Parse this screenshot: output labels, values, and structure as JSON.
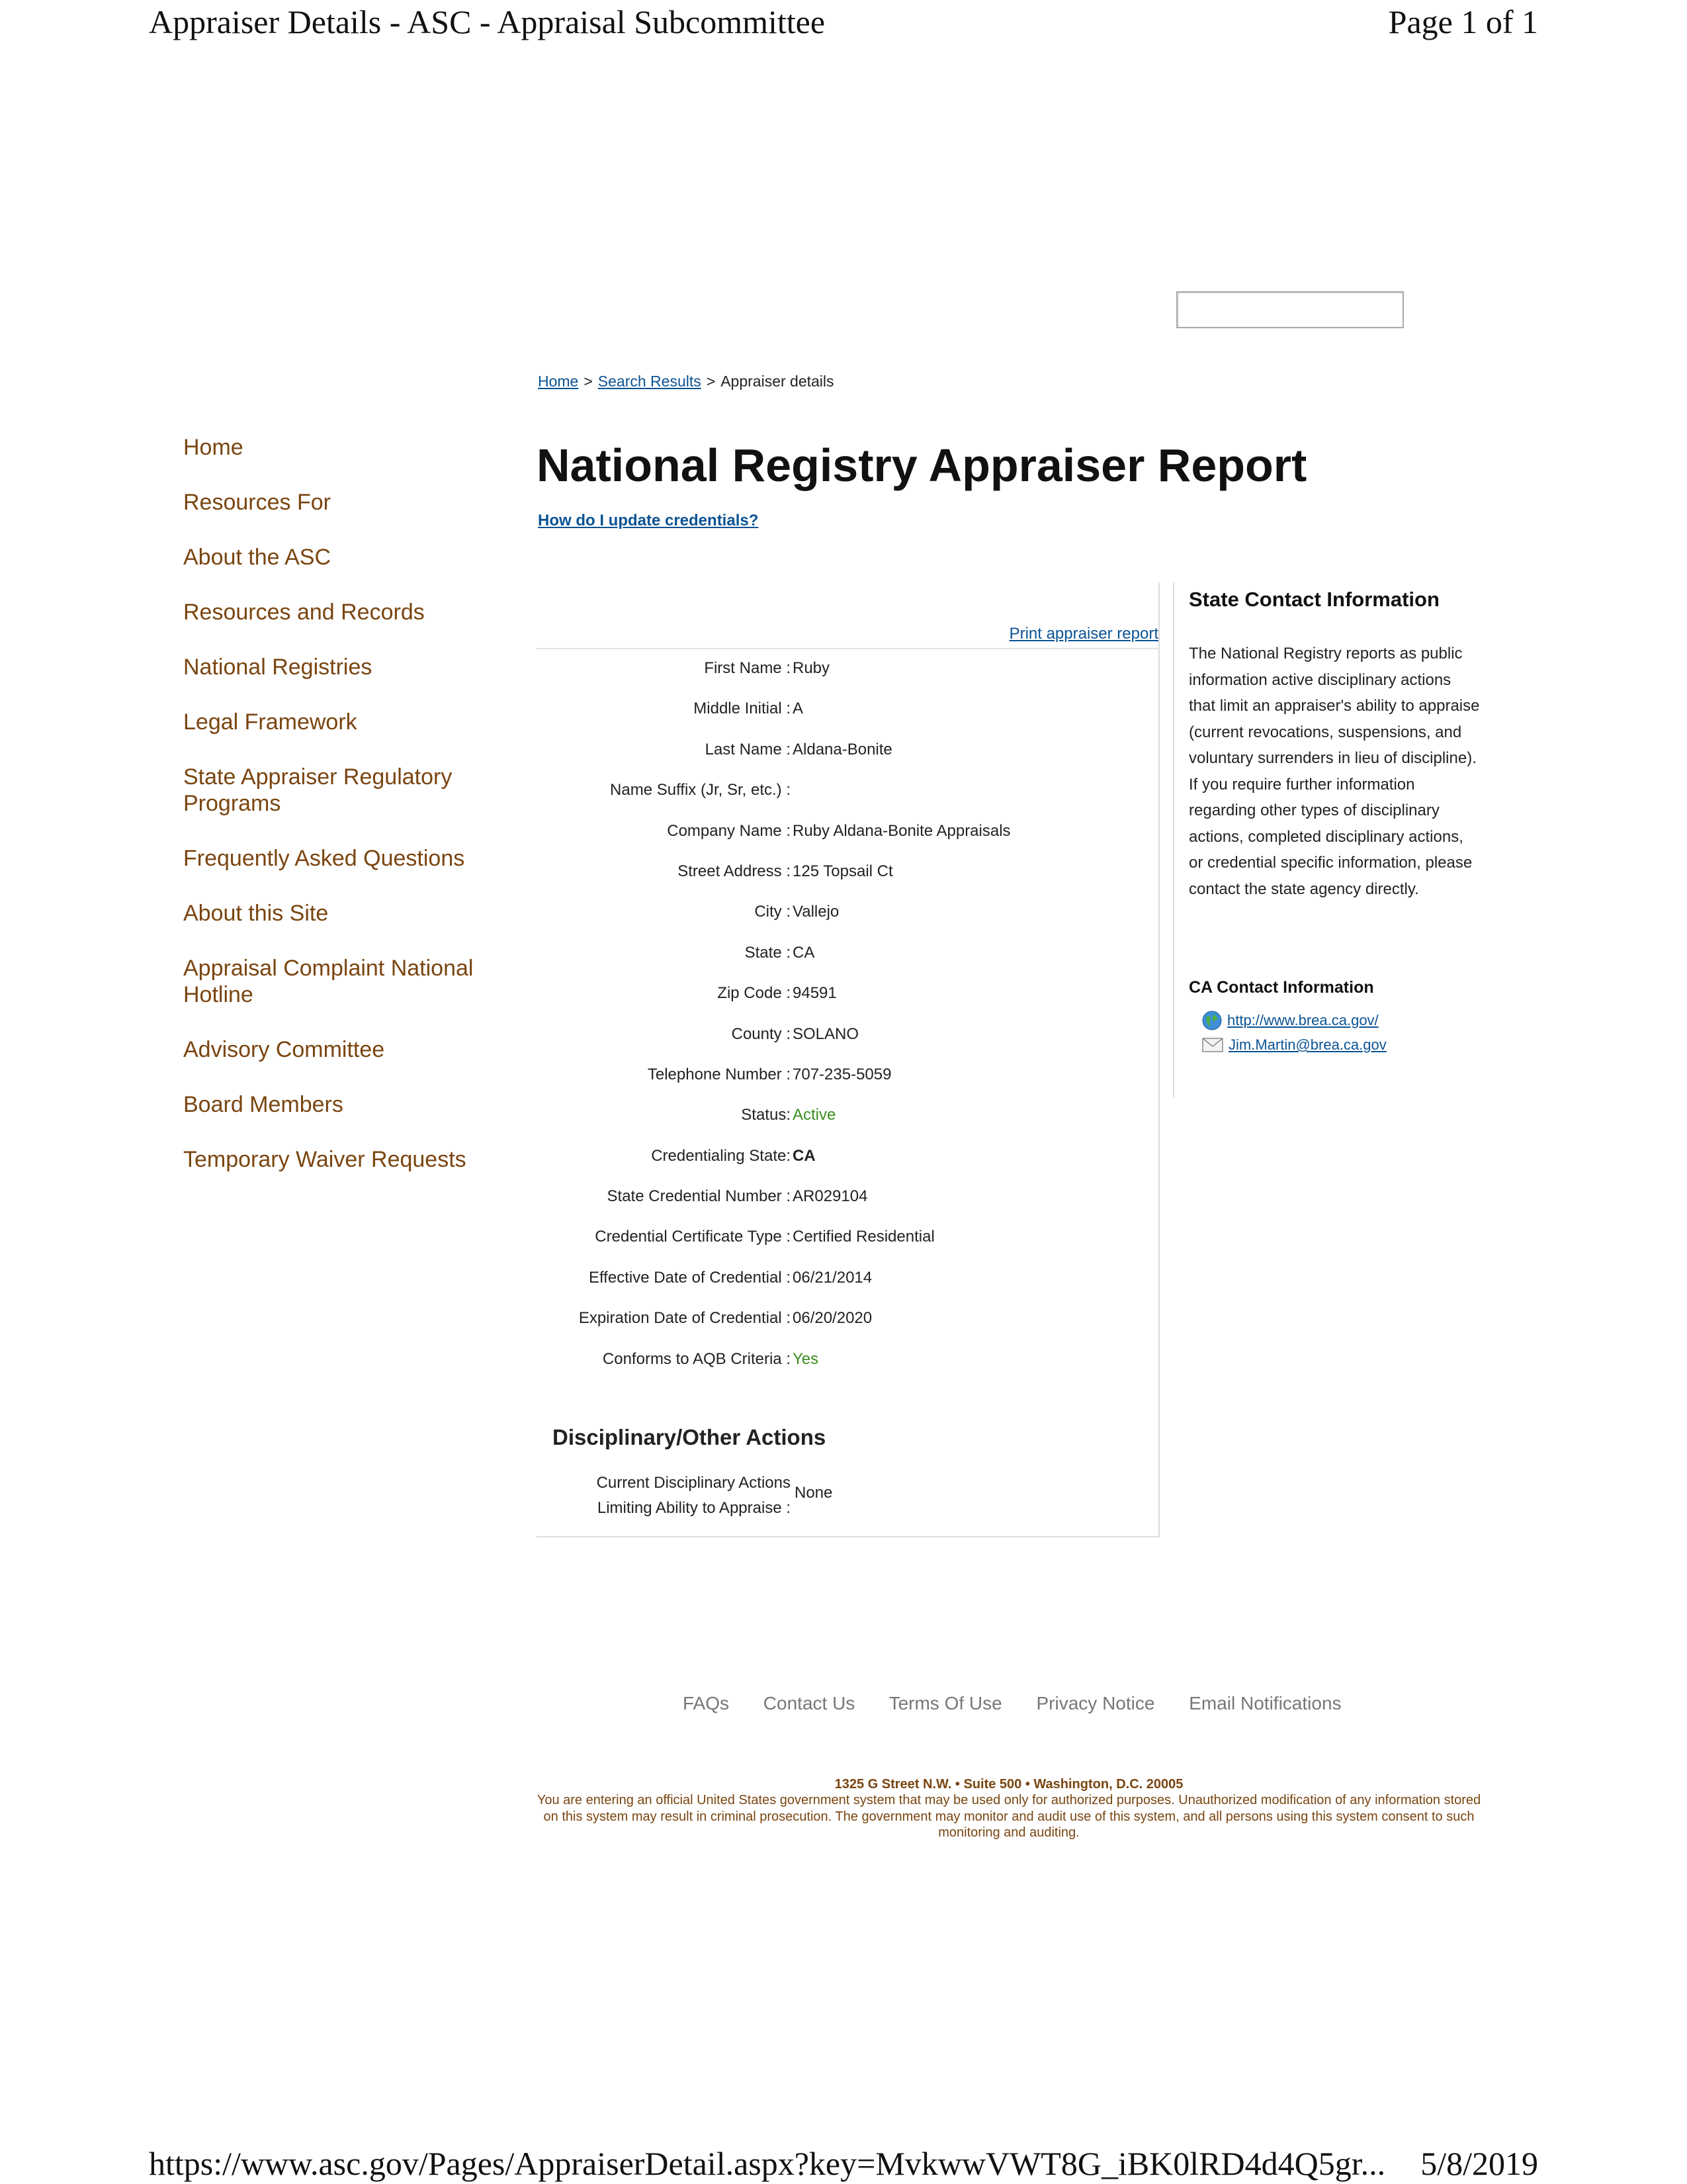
{
  "print_header": {
    "title": "Appraiser Details - ASC - Appraisal Subcommittee",
    "page": "Page 1 of 1"
  },
  "print_footer": {
    "url": "https://www.asc.gov/Pages/AppraiserDetail.aspx?key=MvkwwVWT8G_iBK0lRD4d4Q5gr...",
    "date": "5/8/2019"
  },
  "search": {
    "placeholder": ""
  },
  "breadcrumb": {
    "home": "Home",
    "sep": ">",
    "search_results": "Search Results",
    "current": "Appraiser details"
  },
  "nav": {
    "items": [
      "Home",
      "Resources For",
      "About the ASC",
      "Resources and Records",
      "National Registries",
      "Legal Framework",
      "State Appraiser Regulatory Programs",
      "Frequently Asked Questions",
      "About this Site",
      "Appraisal Complaint National Hotline",
      "Advisory Committee",
      "Board Members",
      "Temporary Waiver Requests"
    ]
  },
  "report": {
    "title": "National Registry Appraiser Report",
    "update_link": "How do I update credentials?",
    "print_link": "Print appraiser report",
    "fields": [
      {
        "label": "First Name :",
        "value": "Ruby"
      },
      {
        "label": "Middle Initial :",
        "value": "A"
      },
      {
        "label": "Last Name :",
        "value": "Aldana-Bonite"
      },
      {
        "label": "Name Suffix (Jr, Sr, etc.) :",
        "value": ""
      },
      {
        "label": "Company Name :",
        "value": "Ruby Aldana-Bonite Appraisals"
      },
      {
        "label": "Street Address :",
        "value": "125 Topsail Ct"
      },
      {
        "label": "City :",
        "value": "Vallejo"
      },
      {
        "label": "State :",
        "value": "CA"
      },
      {
        "label": "Zip Code :",
        "value": "94591"
      },
      {
        "label": "County :",
        "value": "SOLANO"
      },
      {
        "label": "Telephone Number :",
        "value": "707-235-5059"
      },
      {
        "label": "Status:",
        "value": "Active"
      },
      {
        "label": "Credentialing State:",
        "value": "CA"
      },
      {
        "label": "State Credential Number :",
        "value": "AR029104"
      },
      {
        "label": "Credential Certificate Type :",
        "value": "Certified Residential"
      },
      {
        "label": "Effective Date of Credential :",
        "value": "06/21/2014"
      },
      {
        "label": "Expiration Date of Credential :",
        "value": "06/20/2020"
      },
      {
        "label": "Conforms to AQB Criteria :",
        "value": "Yes"
      }
    ],
    "disciplinary": {
      "title": "Disciplinary/Other Actions",
      "label_line1": "Current Disciplinary Actions",
      "label_line2": "Limiting Ability to Appraise :",
      "value": "None"
    }
  },
  "state_contact": {
    "title": "State Contact Information",
    "text": "The National Registry reports as public information active disciplinary actions that limit an appraiser's ability to appraise (current revocations, suspensions, and voluntary surrenders in lieu of discipline). If you require further information regarding other types of disciplinary actions, completed disciplinary actions, or credential specific information, please contact the state agency directly.",
    "ca_title": "CA Contact Information",
    "website": "http://www.brea.ca.gov/",
    "email": "Jim.Martin@brea.ca.gov",
    "icons": {
      "website": "globe-icon",
      "email": "mail-icon"
    }
  },
  "footer": {
    "links": [
      "FAQs",
      "Contact Us",
      "Terms Of Use",
      "Privacy Notice",
      "Email Notifications"
    ],
    "address": "1325 G Street N.W. • Suite 500 • Washington, D.C. 20005",
    "legal": "You are entering an official United States government system that may be used only for authorized purposes. Unauthorized modification of any information stored on this system may result in criminal prosecution. The government may monitor and audit use of this system, and all persons using this system consent to such monitoring and auditing."
  },
  "colors": {
    "nav_text": "#7a4510",
    "link": "#0b5394",
    "status_green": "#3a8f1f",
    "footer_links": "#777777"
  }
}
